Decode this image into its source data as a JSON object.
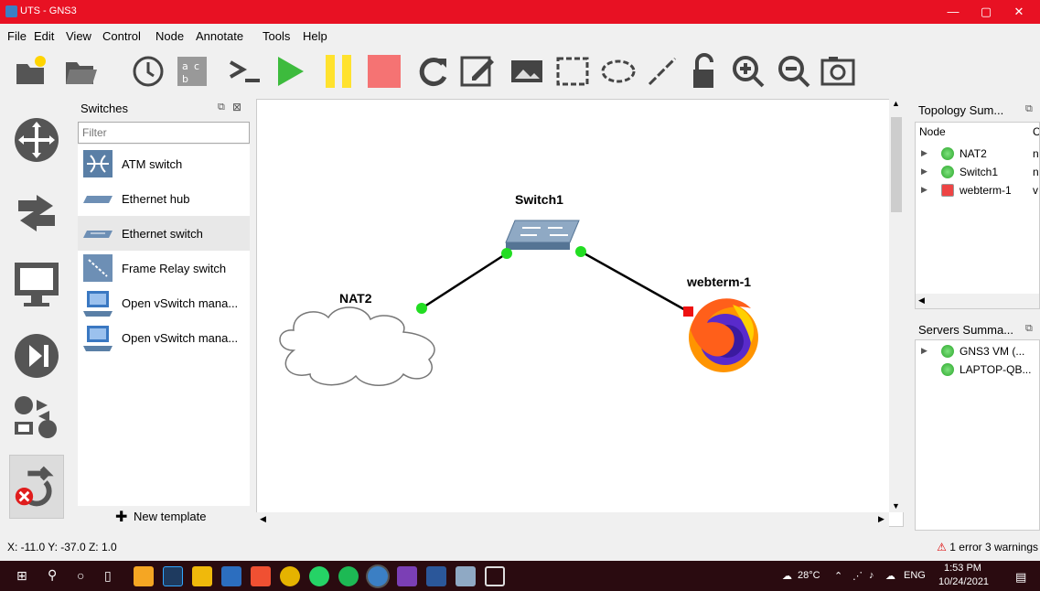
{
  "window": {
    "title": "UTS - GNS3",
    "minimize": "—",
    "restore": "▢",
    "close": "✕"
  },
  "menu": [
    "File",
    "Edit",
    "View",
    "Control",
    "Node",
    "Annotate",
    "Tools",
    "Help"
  ],
  "switches_panel": {
    "title": "Switches",
    "filter_placeholder": "Filter",
    "items": [
      {
        "label": "ATM switch",
        "icon": "atm-switch-icon"
      },
      {
        "label": "Ethernet hub",
        "icon": "ethernet-hub-icon"
      },
      {
        "label": "Ethernet switch",
        "icon": "ethernet-switch-icon"
      },
      {
        "label": "Frame Relay switch",
        "icon": "frame-relay-icon"
      },
      {
        "label": "Open vSwitch mana...",
        "icon": "ovs-icon"
      },
      {
        "label": "Open vSwitch mana...",
        "icon": "ovs-icon"
      }
    ],
    "new_template": "New template"
  },
  "topology": {
    "nodes": [
      {
        "name": "Switch1"
      },
      {
        "name": "NAT2"
      },
      {
        "name": "webterm-1"
      }
    ]
  },
  "topology_summary": {
    "title": "Topology Sum...",
    "col_node": "Node",
    "col_c": "C",
    "rows": [
      {
        "name": "NAT2",
        "c": "n",
        "status": "green"
      },
      {
        "name": "Switch1",
        "c": "n",
        "status": "green"
      },
      {
        "name": "webterm-1",
        "c": "v",
        "status": "red"
      }
    ]
  },
  "servers_summary": {
    "title": "Servers Summa...",
    "rows": [
      {
        "name": "GNS3 VM (..."
      },
      {
        "name": "LAPTOP-QB..."
      }
    ]
  },
  "status": {
    "coords": "X: -11.0 Y: -37.0 Z: 1.0",
    "errors": "1 error 3 warnings"
  },
  "taskbar": {
    "weather": "28°C",
    "lang": "ENG",
    "time": "1:53 PM",
    "date": "10/24/2021"
  },
  "colors": {
    "titlebar": "#e81123",
    "link": "#000000",
    "port_up": "#22dd22",
    "port_down": "#ee1111"
  }
}
